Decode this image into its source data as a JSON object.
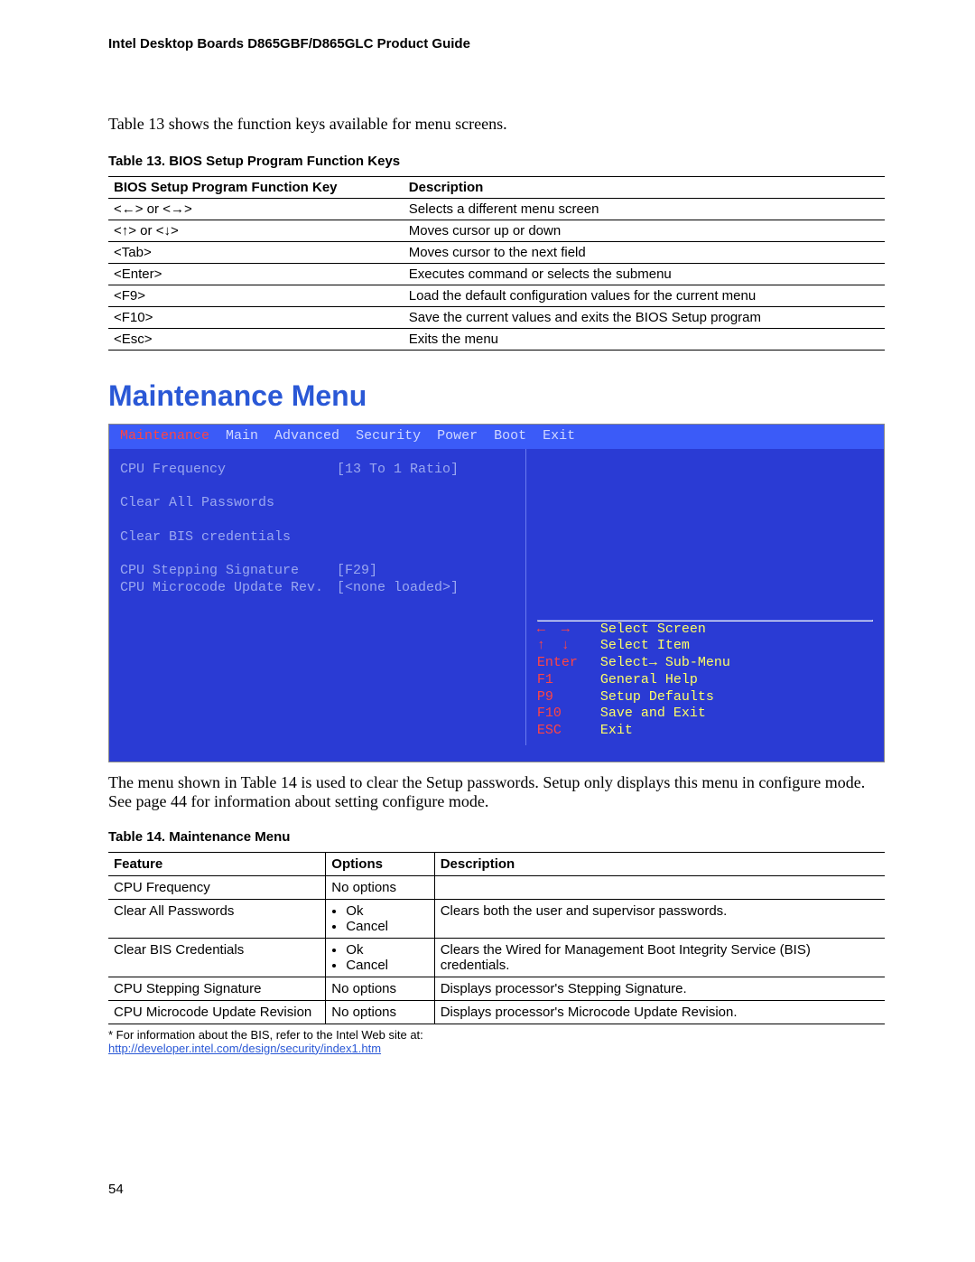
{
  "header": "Intel Desktop Boards D865GBF/D865GLC Product Guide",
  "intro": "Table 13 shows the function keys available for menu screens.",
  "table13": {
    "caption": "Table 13.    BIOS Setup Program Function Keys",
    "col1": "BIOS Setup Program Function Key",
    "col2": "Description",
    "rows": [
      {
        "k": "<←> or <→>",
        "d": "Selects a different menu screen"
      },
      {
        "k": "<↑> or <↓>",
        "d": "Moves cursor up or down"
      },
      {
        "k": "<Tab>",
        "d": "Moves cursor to the next field"
      },
      {
        "k": "<Enter>",
        "d": "Executes command or selects the submenu"
      },
      {
        "k": "<F9>",
        "d": "Load the default configuration values for the current menu"
      },
      {
        "k": "<F10>",
        "d": "Save the current values and exits the BIOS Setup program"
      },
      {
        "k": "<Esc>",
        "d": "Exits the menu"
      }
    ]
  },
  "section_title": "Maintenance Menu",
  "bios": {
    "menu": [
      "Maintenance",
      "Main",
      "Advanced",
      "Security",
      "Power",
      "Boot",
      "Exit"
    ],
    "items": [
      {
        "label": "CPU Frequency",
        "value": "[13 To 1 Ratio]"
      },
      {
        "label": "",
        "value": ""
      },
      {
        "label": "Clear All Passwords",
        "value": ""
      },
      {
        "label": "",
        "value": ""
      },
      {
        "label": "Clear BIS credentials",
        "value": ""
      },
      {
        "label": "",
        "value": ""
      },
      {
        "label": "CPU Stepping Signature",
        "value": "[F29]"
      },
      {
        "label": "CPU Microcode Update Rev.",
        "value": "[<none loaded>]"
      }
    ],
    "help": [
      {
        "key": "←  →",
        "desc": "Select Screen"
      },
      {
        "key": "↑  ↓",
        "desc": "Select Item"
      },
      {
        "key": "Enter",
        "desc": "Select→ Sub-Menu"
      },
      {
        "key": "F1",
        "desc": "General Help"
      },
      {
        "key": "P9",
        "desc": "Setup Defaults"
      },
      {
        "key": "F10",
        "desc": "Save and Exit"
      },
      {
        "key": "ESC",
        "desc": "Exit"
      }
    ]
  },
  "para2": "The menu shown in Table 14 is used to clear the Setup passwords.  Setup only displays this menu in configure mode.  See page 44 for information about setting configure mode.",
  "table14": {
    "caption": "Table 14.    Maintenance Menu",
    "col1": "Feature",
    "col2": "Options",
    "col3": "Description",
    "rows": [
      {
        "f": "CPU Frequency",
        "o_text": "No options",
        "d": ""
      },
      {
        "f": "Clear All Passwords",
        "o_list": [
          "Ok",
          "Cancel"
        ],
        "d": "Clears both the user and supervisor passwords."
      },
      {
        "f": "Clear BIS Credentials",
        "o_list": [
          "Ok",
          "Cancel"
        ],
        "d": "Clears the Wired for Management Boot Integrity Service (BIS) credentials."
      },
      {
        "f": "CPU Stepping Signature",
        "o_text": "No options",
        "d": "Displays processor's Stepping Signature."
      },
      {
        "f": "CPU Microcode Update Revision",
        "o_text": "No options",
        "d": "Displays processor's Microcode Update Revision."
      }
    ]
  },
  "footnote_prefix": "*  For information about the BIS, refer to the Intel Web site at:",
  "footnote_link": "http://developer.intel.com/design/security/index1.htm",
  "pagenum": "54"
}
